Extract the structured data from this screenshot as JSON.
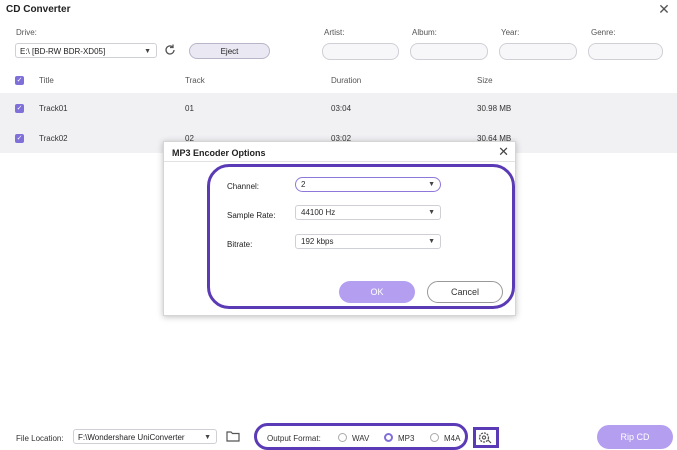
{
  "window": {
    "title": "CD Converter"
  },
  "top": {
    "drive_label": "Drive:",
    "drive_value": "E:\\ [BD-RW  BDR-XD05]",
    "eject_label": "Eject",
    "artist_label": "Artist:",
    "album_label": "Album:",
    "year_label": "Year:",
    "genre_label": "Genre:"
  },
  "table": {
    "headers": {
      "title": "Title",
      "track": "Track",
      "duration": "Duration",
      "size": "Size"
    },
    "rows": [
      {
        "title": "Track01",
        "track": "01",
        "duration": "03:04",
        "size": "30.98 MB"
      },
      {
        "title": "Track02",
        "track": "02",
        "duration": "03:02",
        "size": "30.64 MB"
      }
    ]
  },
  "dialog": {
    "title": "MP3 Encoder Options",
    "channel_label": "Channel:",
    "channel_value": "2",
    "sample_rate_label": "Sample Rate:",
    "sample_rate_value": "44100 Hz",
    "bitrate_label": "Bitrate:",
    "bitrate_value": "192 kbps",
    "ok_label": "OK",
    "cancel_label": "Cancel"
  },
  "bottom": {
    "file_location_label": "File Location:",
    "file_location_value": "F:\\Wondershare UniConverter",
    "output_format_label": "Output Format:",
    "formats": [
      "WAV",
      "MP3",
      "M4A"
    ],
    "selected_format": "MP3",
    "rip_label": "Rip CD"
  },
  "colors": {
    "accent": "#7f6fd8",
    "highlight": "#5b3bb5",
    "button": "#b49ef0"
  }
}
